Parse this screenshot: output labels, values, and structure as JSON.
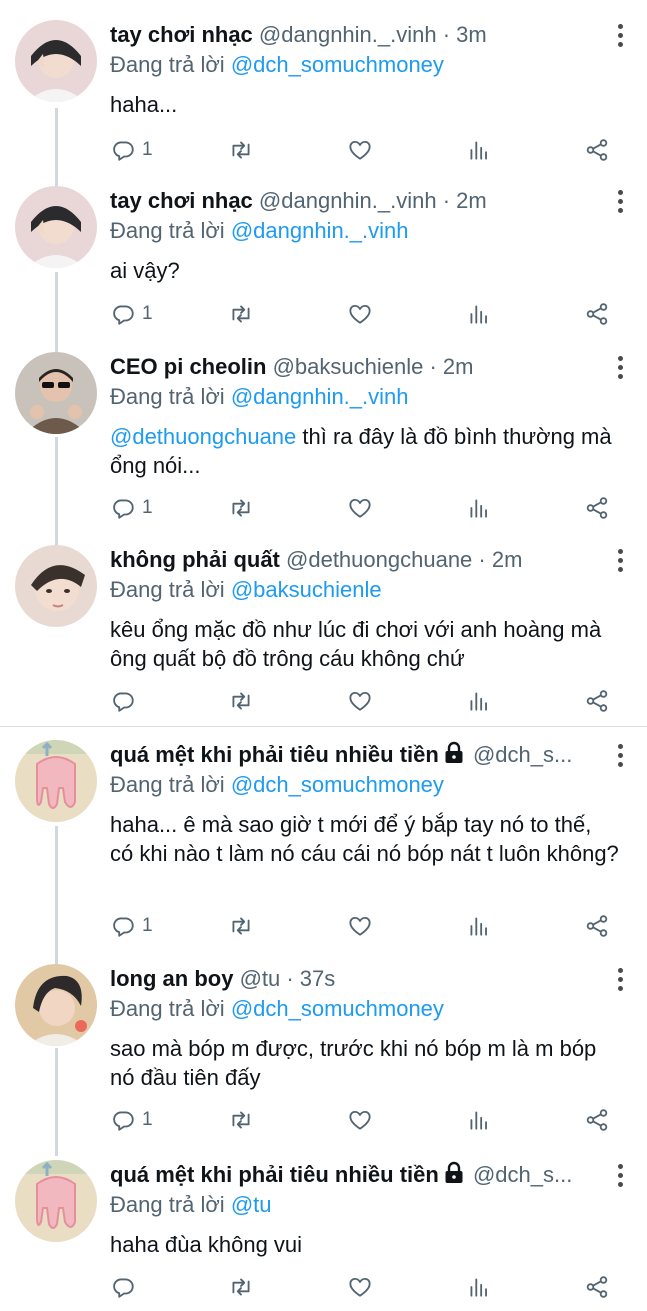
{
  "colors": {
    "accent": "#1d9bf0",
    "text": "#0f1419",
    "secondary": "#536471",
    "thread_line": "#cfd9de"
  },
  "icons": {
    "reply": "reply-icon",
    "retweet": "retweet-icon",
    "like": "heart-icon",
    "stats": "stats-icon",
    "share": "share-icon",
    "more": "more-vertical-icon",
    "lock": "lock-icon"
  },
  "tweets": [
    {
      "name": "tay chơi nhạc",
      "meta": "@dangnhin._.vinh · 3m",
      "reply_prefix": "Đang trả lời ",
      "reply_handle": "@dch_somuchmoney",
      "text": "haha...",
      "mention": "",
      "reply_count": "1"
    },
    {
      "name": "tay chơi nhạc",
      "meta": "@dangnhin._.vinh · 2m",
      "reply_prefix": "Đang trả lời ",
      "reply_handle": "@dangnhin._.vinh",
      "text": "ai vậy?",
      "mention": "",
      "reply_count": "1"
    },
    {
      "name": "CEO pi cheolin",
      "meta": "@baksuchienle · 2m",
      "reply_prefix": "Đang trả lời ",
      "reply_handle": "@dangnhin._.vinh",
      "mention": "@dethuongchuane",
      "text": " thì ra đây là đồ bình thường mà ổng nói...",
      "reply_count": "1"
    },
    {
      "name": "không phải quất",
      "meta": "@dethuongchuane · 2m",
      "reply_prefix": "Đang trả lời ",
      "reply_handle": "@baksuchienle",
      "text": "kêu ổng mặc đồ như lúc đi chơi với anh hoàng mà ông quất bộ đồ trông cáu không chứ",
      "mention": "",
      "reply_count": ""
    },
    {
      "name": "quá mệt khi phải tiêu nhiều tiền",
      "meta": "@dch_s...",
      "locked": true,
      "reply_prefix": "Đang trả lời ",
      "reply_handle": "@dch_somuchmoney",
      "text": "haha... ê mà sao giờ t mới để ý bắp tay nó to thế, có khi nào t làm nó cáu cái nó bóp nát t luôn không?",
      "mention": "",
      "reply_count": "1"
    },
    {
      "name": "long an boy",
      "meta": "@tu · 37s",
      "reply_prefix": "Đang trả lời ",
      "reply_handle": "@dch_somuchmoney",
      "text": "sao mà bóp m được, trước khi nó bóp m là m bóp nó đầu tiên đấy",
      "mention": "",
      "reply_count": "1"
    },
    {
      "name": "quá mệt khi phải tiêu nhiều tiền",
      "meta": "@dch_s...",
      "locked": true,
      "reply_prefix": "Đang trả lời ",
      "reply_handle": "@tu",
      "text": "haha đùa không vui",
      "mention": "",
      "reply_count": ""
    }
  ]
}
